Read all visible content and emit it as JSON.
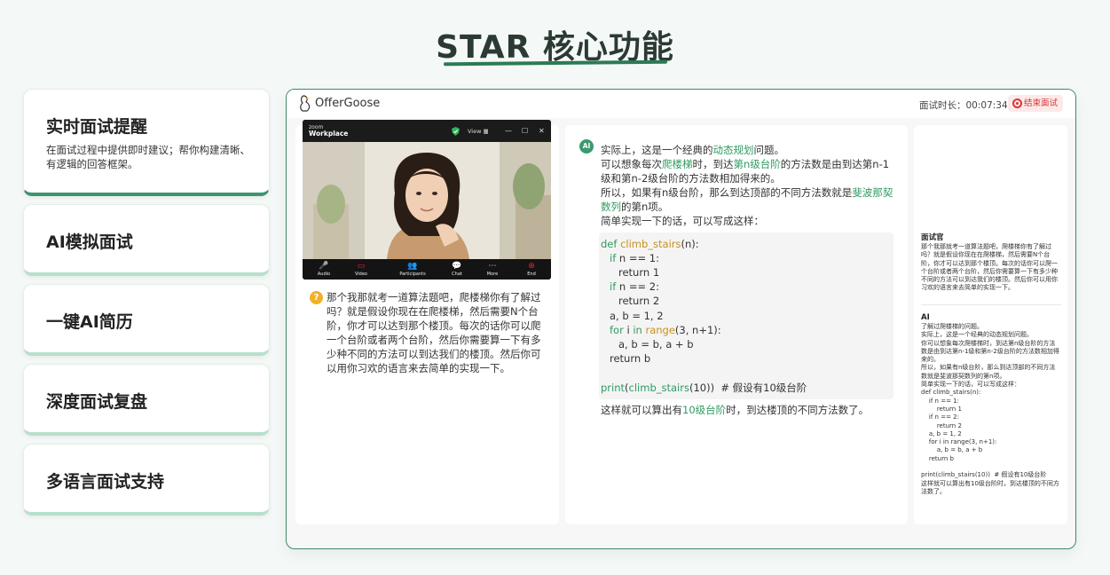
{
  "header": {
    "title": "STAR 核心功能"
  },
  "features": [
    {
      "title": "实时面试提醒",
      "desc": "在面试过程中提供即时建议；帮你构建清晰、有逻辑的回答框架。"
    },
    {
      "title": "AI模拟面试"
    },
    {
      "title": "一键AI简历"
    },
    {
      "title": "深度面试复盘"
    },
    {
      "title": "多语言面试支持"
    }
  ],
  "window": {
    "brand": "OfferGoose",
    "timer_label": "面试时长：",
    "timer_value": "00:07:34",
    "end_button": "结束面试"
  },
  "zoom": {
    "brand_line1": "zoom",
    "brand_line2": "Workplace",
    "view": "View",
    "controls": [
      {
        "icon": "microphone-icon",
        "label": "Audio",
        "glyph": "🎤"
      },
      {
        "icon": "video-off-icon",
        "label": "Video",
        "glyph": "▭"
      },
      {
        "icon": "participants-icon",
        "label": "Participants",
        "glyph": "👥"
      },
      {
        "icon": "chat-icon",
        "label": "Chat",
        "glyph": "💬"
      },
      {
        "icon": "more-icon",
        "label": "More",
        "glyph": "⋯"
      },
      {
        "icon": "end-call-icon",
        "label": "End",
        "glyph": "⊗"
      }
    ]
  },
  "question": {
    "icon": "?",
    "text": "那个我那就考一道算法题吧，爬楼梯你有了解过吗？就是假设你现在在爬楼梯，然后需要N个台阶，你才可以达到那个楼顶。每次的话你可以爬一个台阶或者两个台阶，然后你需要算一下有多少种不同的方法可以到达我们的楼顶。然后你可以用你习欢的语言来去简单的实现一下。"
  },
  "answer": {
    "icon": "AI",
    "p1_a": "实际上，这是一个经典的",
    "p1_hl": "动态规划",
    "p1_b": "问题。",
    "p2_a": "可以想象每次",
    "p2_hl1": "爬楼梯",
    "p2_b": "时，到达",
    "p2_hl2": "第n级台阶",
    "p2_c": "的方法数是由到达第n-1级和第n-2级台阶的方法数相加得来的。",
    "p3_a": "所以，如果有n级台阶，那么到达顶部的不同方法数就是",
    "p3_hl": "斐波那契数列",
    "p3_b": "的第n项。",
    "p4": "简单实现一下的话，可以写成这样：",
    "code": {
      "l1_kw": "def ",
      "l1_fn": "climb_stairs",
      "l1_rest": "(n):",
      "l2_kw": "if ",
      "l2_rest": "n == 1:",
      "l3": "return 1",
      "l4_kw": "if ",
      "l4_rest": "n == 2:",
      "l5": "return 2",
      "l6": "a, b = 1, 2",
      "l7_kw": "for ",
      "l7_i": "i ",
      "l7_in": "in ",
      "l7_fn": "range",
      "l7_rest": "(3, n+1):",
      "l8": "a, b = b, a + b",
      "l9": "return b",
      "l10_fn": "print",
      "l10_p": "(",
      "l10_fn2": "climb_stairs",
      "l10_rest": "(10))  # 假设有10级台阶"
    },
    "after_a": "这样就可以算出有",
    "after_hl": "10级台阶",
    "after_b": "时，到达楼顶的不同方法数了。"
  },
  "transcript": {
    "interviewer_label": "面试官",
    "interviewer_text": "那个我那就考一道算法题吧，爬楼梯你有了解过吗？就是假设你现在在爬楼梯，然后需要N个台阶，你才可以达到那个楼顶。每次的话你可以爬一个台阶或者两个台阶，然后你需要算一下有多少种不同的方法可以到达我们的楼顶。然后你可以用你习欢的语言来去简单的实现一下。",
    "ai_label": "AI",
    "ai_text": "了解过爬楼梯的问题。\n实际上，这是一个经典的动态规划问题。\n你可以想象每次爬楼梯时，到达第n级台阶的方法数是由到达第n-1级和第n-2级台阶的方法数相加得来的。\n所以，如果有n级台阶，那么到达顶部的不同方法数就是斐波那契数列的第n项。\n简单实现一下的话，可以写成这样：\ndef climb_stairs(n):\n    if n == 1:\n        return 1\n    if n == 2:\n        return 2\n    a, b = 1, 2\n    for i in range(3, n+1):\n        a, b = b, a + b\n    return b\n\nprint(climb_stairs(10))  # 假设有10级台阶\n这样就可以算出有10级台阶时，到达楼顶的不同方法数了。"
  },
  "colors": {
    "accent": "#2f9a62",
    "end_red": "#dd3333",
    "question_orange": "#f2b02a"
  }
}
